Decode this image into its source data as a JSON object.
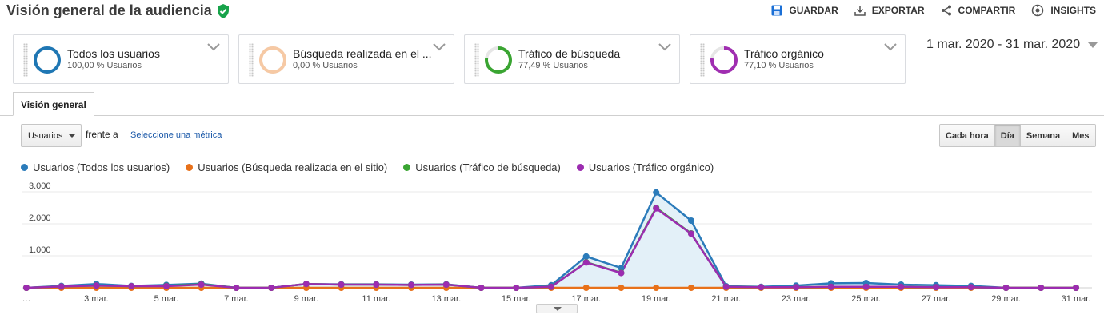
{
  "header": {
    "title": "Visión general de la audiencia",
    "actions": [
      {
        "label": "GUARDAR",
        "icon": "save-icon"
      },
      {
        "label": "EXPORTAR",
        "icon": "export-icon"
      },
      {
        "label": "COMPARTIR",
        "icon": "share-icon"
      },
      {
        "label": "INSIGHTS",
        "icon": "insights-icon"
      }
    ]
  },
  "segments": [
    {
      "name": "Todos los usuarios",
      "pct": "100,00 % Usuarios",
      "color": "#1f77b4",
      "fill": 1.0
    },
    {
      "name": "Búsqueda realizada en el ...",
      "pct": "0,00 % Usuarios",
      "color": "#f6c9a4",
      "fill": 1.0
    },
    {
      "name": "Tráfico de búsqueda",
      "pct": "77,49 % Usuarios",
      "color": "#3aa532",
      "fill": 0.7749
    },
    {
      "name": "Tráfico orgánico",
      "pct": "77,10 % Usuarios",
      "color": "#a02eb1",
      "fill": 0.771
    }
  ],
  "date_range": "1 mar. 2020 - 31 mar. 2020",
  "tabs": {
    "overview": "Visión general"
  },
  "controls": {
    "metric": "Usuarios",
    "versus": "frente a",
    "pick_metric": "Seleccione una métrica",
    "granularity": [
      "Cada hora",
      "Día",
      "Semana",
      "Mes"
    ],
    "active_granularity": "Día"
  },
  "chart_data": {
    "type": "line",
    "x": [
      "1 mar.",
      "2 mar.",
      "3 mar.",
      "4 mar.",
      "5 mar.",
      "6 mar.",
      "7 mar.",
      "8 mar.",
      "9 mar.",
      "10 mar.",
      "11 mar.",
      "12 mar.",
      "13 mar.",
      "14 mar.",
      "15 mar.",
      "16 mar.",
      "17 mar.",
      "18 mar.",
      "19 mar.",
      "20 mar.",
      "21 mar.",
      "22 mar.",
      "23 mar.",
      "24 mar.",
      "25 mar.",
      "26 mar.",
      "27 mar.",
      "28 mar.",
      "29 mar.",
      "30 mar.",
      "31 mar."
    ],
    "x_tick_labels": [
      "…",
      "3 mar.",
      "5 mar.",
      "7 mar.",
      "9 mar.",
      "11 mar.",
      "13 mar.",
      "15 mar.",
      "17 mar.",
      "19 mar.",
      "21 mar.",
      "23 mar.",
      "25 mar.",
      "27 mar.",
      "29 mar.",
      "31 mar."
    ],
    "y_ticks": [
      "1.000",
      "2.000",
      "3.000"
    ],
    "ylim": [
      0,
      3250
    ],
    "grid": true,
    "legend_position": "top-left",
    "series": [
      {
        "name": "Usuarios (Todos los usuarios)",
        "color": "#2b7bba",
        "area": true,
        "values": [
          0,
          60,
          120,
          60,
          90,
          130,
          0,
          0,
          120,
          110,
          110,
          100,
          110,
          0,
          0,
          80,
          980,
          620,
          2980,
          2100,
          50,
          30,
          70,
          140,
          150,
          100,
          80,
          60,
          0,
          0,
          0
        ]
      },
      {
        "name": "Usuarios (Búsqueda realizada en el sitio)",
        "color": "#e8711a",
        "area": false,
        "values": [
          0,
          0,
          0,
          0,
          0,
          0,
          0,
          0,
          0,
          0,
          0,
          0,
          0,
          0,
          0,
          0,
          0,
          0,
          0,
          0,
          0,
          0,
          0,
          0,
          0,
          0,
          0,
          0,
          0,
          0,
          0
        ]
      },
      {
        "name": "Usuarios (Tráfico de búsqueda)",
        "color": "#3aa532",
        "area": false,
        "values": [
          0,
          40,
          70,
          50,
          60,
          110,
          0,
          0,
          120,
          100,
          100,
          90,
          100,
          0,
          0,
          30,
          800,
          470,
          2500,
          1700,
          30,
          20,
          20,
          30,
          30,
          30,
          20,
          20,
          0,
          0,
          0
        ]
      },
      {
        "name": "Usuarios (Tráfico orgánico)",
        "color": "#9c2cb0",
        "area": false,
        "values": [
          0,
          40,
          70,
          50,
          50,
          100,
          0,
          0,
          120,
          100,
          100,
          90,
          100,
          0,
          0,
          30,
          790,
          460,
          2480,
          1690,
          30,
          20,
          20,
          30,
          30,
          30,
          20,
          20,
          0,
          0,
          0
        ]
      }
    ]
  }
}
